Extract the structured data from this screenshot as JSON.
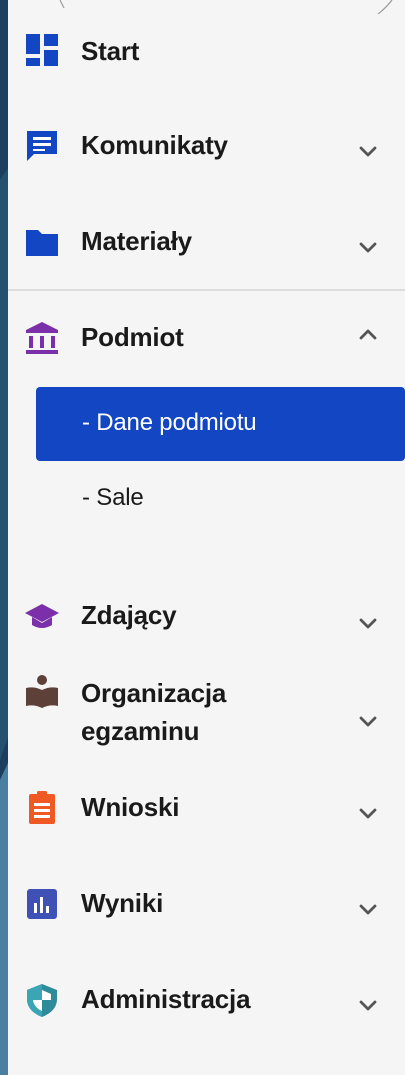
{
  "menu": {
    "start": {
      "label": "Start",
      "icon": "dashboard-icon"
    },
    "komunikaty": {
      "label": "Komunikaty",
      "icon": "message-icon"
    },
    "materialy": {
      "label": "Materiały",
      "icon": "folder-icon"
    },
    "podmiot": {
      "label": "Podmiot",
      "icon": "institution-icon",
      "expanded": true,
      "sub": [
        {
          "label": "- Dane podmiotu",
          "active": true
        },
        {
          "label": "- Sale",
          "active": false
        }
      ]
    },
    "zdajacy": {
      "label": "Zdający",
      "icon": "graduation-cap-icon"
    },
    "organizacja": {
      "label_line1": "Organizacja",
      "label_line2": "egzaminu",
      "icon": "reading-icon"
    },
    "wnioski": {
      "label": "Wnioski",
      "icon": "clipboard-icon"
    },
    "wyniki": {
      "label": "Wyniki",
      "icon": "bar-chart-icon"
    },
    "administracja": {
      "label": "Administracja",
      "icon": "shield-icon"
    }
  },
  "colors": {
    "active_bg": "#1346c2",
    "blue_icon": "#1346c2",
    "purple_icon": "#7b2fa8",
    "brown_icon": "#5d4037",
    "orange_icon": "#ef5a24",
    "indigo_icon": "#3f51b5",
    "teal_icon": "#2e8b9a"
  }
}
